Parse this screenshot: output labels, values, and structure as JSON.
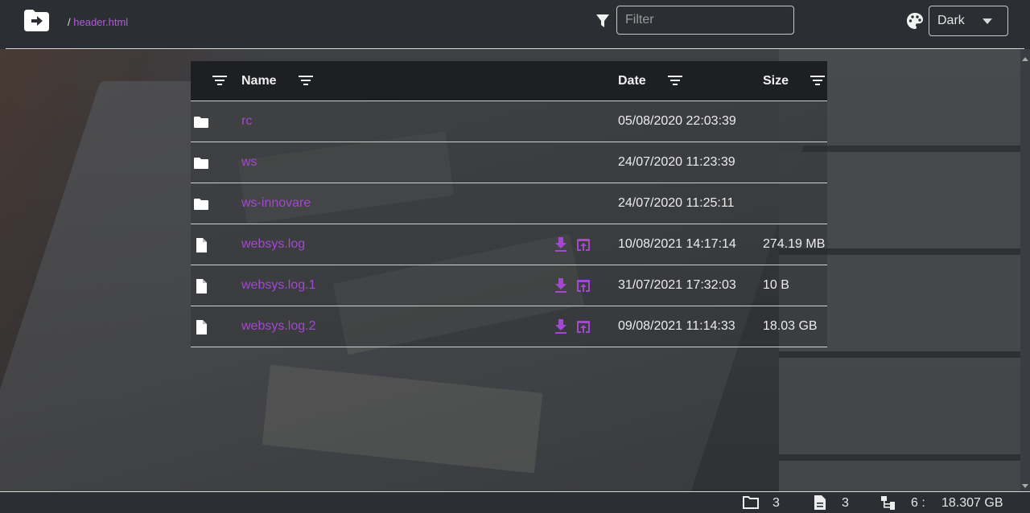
{
  "header": {
    "breadcrumb_sep": "/",
    "breadcrumb_file": "header.html",
    "filter_placeholder": "Filter",
    "theme_value": "Dark"
  },
  "table": {
    "columns": {
      "name": "Name",
      "date": "Date",
      "size": "Size"
    },
    "rows": [
      {
        "type": "folder",
        "name": "rc",
        "date": "05/08/2020 22:03:39",
        "size": ""
      },
      {
        "type": "folder",
        "name": "ws",
        "date": "24/07/2020 11:23:39",
        "size": ""
      },
      {
        "type": "folder",
        "name": "ws-innovare",
        "date": "24/07/2020 11:25:11",
        "size": ""
      },
      {
        "type": "file",
        "name": "websys.log",
        "date": "10/08/2021 14:17:14",
        "size": "274.19 MB"
      },
      {
        "type": "file",
        "name": "websys.log.1",
        "date": "31/07/2021 17:32:03",
        "size": "10 B"
      },
      {
        "type": "file",
        "name": "websys.log.2",
        "date": "09/08/2021 11:14:33",
        "size": "18.03 GB"
      }
    ]
  },
  "footer": {
    "folder_count": "3",
    "file_count": "3",
    "total_count": "6 :",
    "total_size": "18.307 GB"
  },
  "colors": {
    "accent": "#a348d0",
    "background": "#2b2e33",
    "header_row": "#1d1f22"
  }
}
